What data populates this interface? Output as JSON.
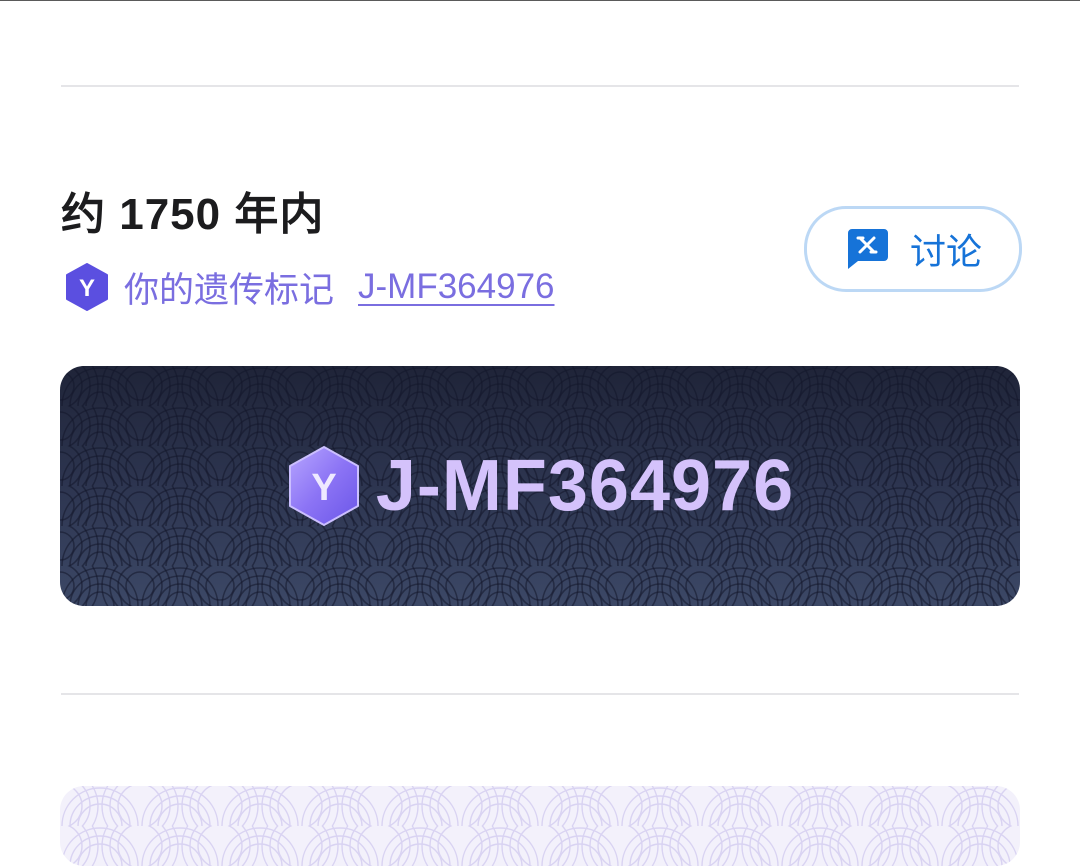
{
  "section": {
    "heading": "约 1750 年内",
    "marker_label": "你的遗传标记",
    "marker_link": "J-MF364976",
    "haplogroup_badge_letter": "Y"
  },
  "discuss_button": {
    "label": "讨论",
    "icon": "chat-bubble-icon"
  },
  "banner": {
    "title": "J-MF364976",
    "badge_letter": "Y"
  },
  "colors": {
    "accent_purple": "#7a6ee0",
    "discuss_blue": "#1673d8",
    "banner_text": "#d4c2fb",
    "banner_bg_top": "#1f2438",
    "banner_bg_bottom": "#3c4866"
  }
}
